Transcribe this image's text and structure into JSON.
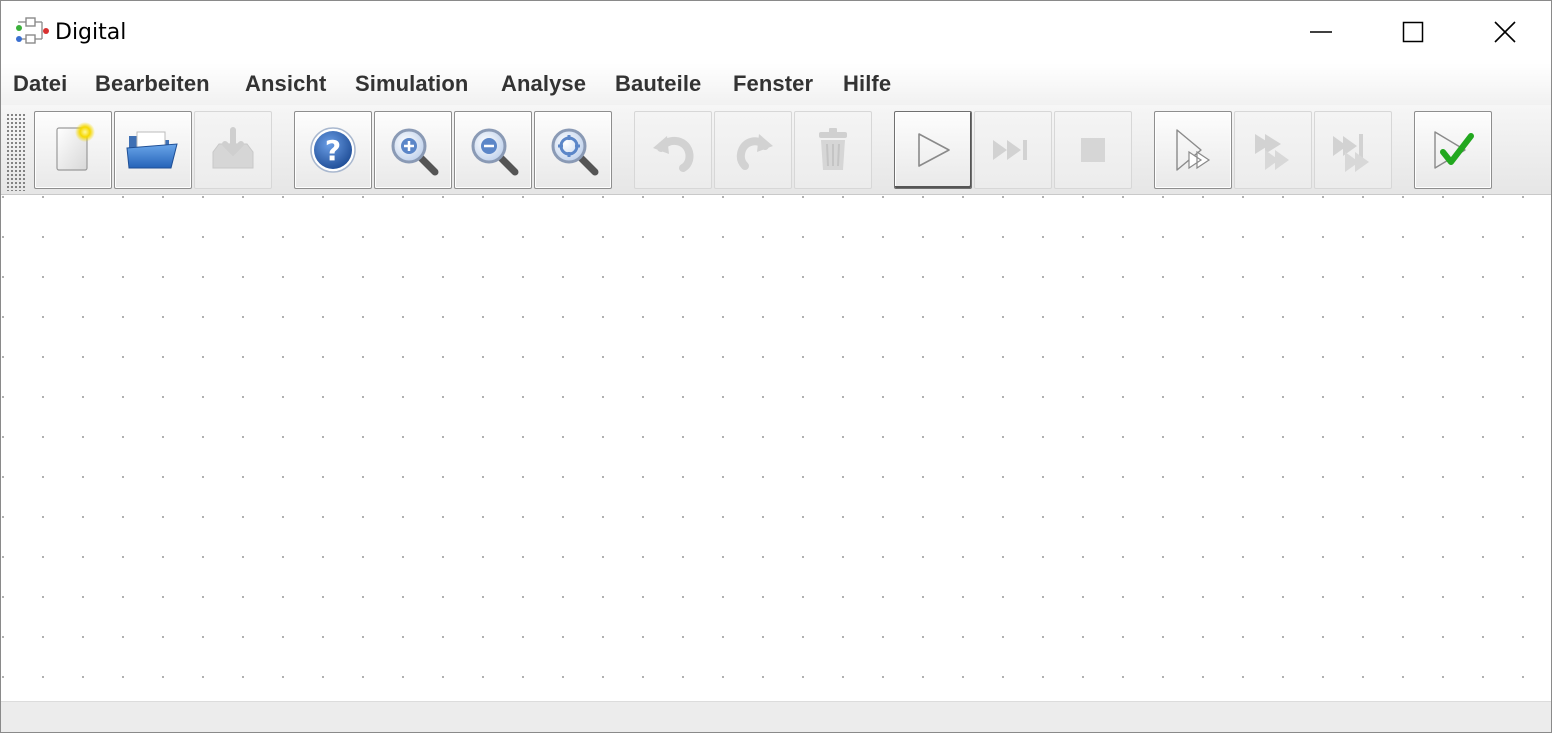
{
  "window": {
    "title": "Digital",
    "icon": "circuit-app-icon",
    "controls": {
      "minimize": "minimize-icon",
      "maximize": "maximize-icon",
      "close": "close-icon"
    }
  },
  "menu": {
    "items": [
      "Datei",
      "Bearbeiten",
      "Ansicht",
      "Simulation",
      "Analyse",
      "Bauteile",
      "Fenster",
      "Hilfe"
    ]
  },
  "toolbar": {
    "buttons": [
      {
        "name": "new",
        "icon": "new-document-icon",
        "enabled": true
      },
      {
        "name": "open",
        "icon": "open-folder-icon",
        "enabled": true
      },
      {
        "name": "save",
        "icon": "save-icon",
        "enabled": false
      },
      {
        "name": "help",
        "icon": "help-icon",
        "enabled": true
      },
      {
        "name": "zoom-in",
        "icon": "zoom-in-icon",
        "enabled": true
      },
      {
        "name": "zoom-out",
        "icon": "zoom-out-icon",
        "enabled": true
      },
      {
        "name": "zoom-fit",
        "icon": "zoom-fit-icon",
        "enabled": true
      },
      {
        "name": "undo",
        "icon": "undo-icon",
        "enabled": false
      },
      {
        "name": "redo",
        "icon": "redo-icon",
        "enabled": false
      },
      {
        "name": "delete",
        "icon": "trash-icon",
        "enabled": false
      },
      {
        "name": "start-simulation",
        "icon": "play-icon",
        "enabled": true
      },
      {
        "name": "step",
        "icon": "step-icon",
        "enabled": false
      },
      {
        "name": "stop",
        "icon": "stop-icon",
        "enabled": false
      },
      {
        "name": "micro-step",
        "icon": "micro-step-icon",
        "enabled": true
      },
      {
        "name": "run-to-break",
        "icon": "run-to-break-icon",
        "enabled": false
      },
      {
        "name": "run-to-break-micro",
        "icon": "run-to-break-micro-icon",
        "enabled": false
      },
      {
        "name": "run-tests",
        "icon": "run-tests-icon",
        "enabled": true
      }
    ]
  },
  "colors": {
    "menu_text": "#333333",
    "grid_dot": "#b0b0b0",
    "help_blue": "#2c5fa8",
    "check_green": "#22a81f",
    "folder_blue": "#3a7cd0"
  }
}
